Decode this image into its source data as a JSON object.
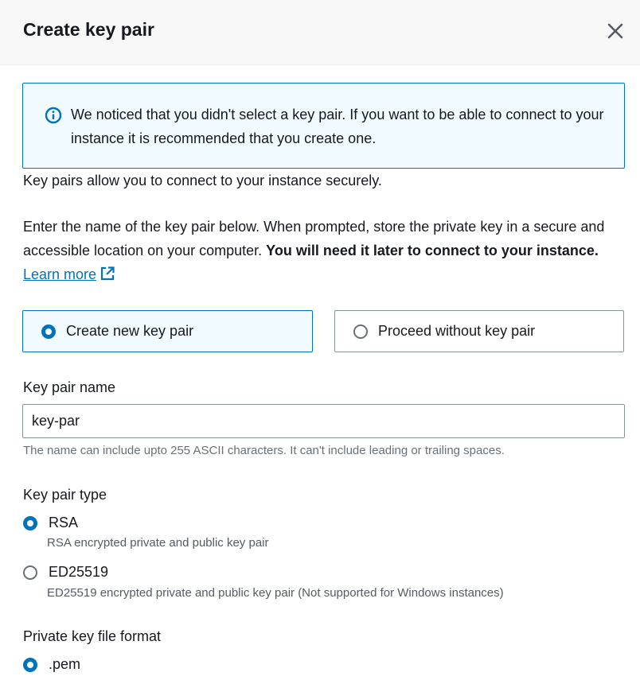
{
  "dialog": {
    "title": "Create key pair",
    "close_icon": "close-icon"
  },
  "alert": {
    "icon": "info-icon",
    "message": "We noticed that you didn't select a key pair. If you want to be able to connect to your instance it is recommended that you create one."
  },
  "intro": {
    "line1": "Key pairs allow you to connect to your instance securely.",
    "line2_prefix": "Enter the name of the key pair below. When prompted, store the private key in a secure and accessible location on your computer. ",
    "line2_bold": "You will need it later to connect to your instance.",
    "learn_more": "Learn more",
    "learn_more_icon": "external-link-icon"
  },
  "choice_tiles": [
    {
      "label": "Create new key pair",
      "selected": true
    },
    {
      "label": "Proceed without key pair",
      "selected": false
    }
  ],
  "key_pair_name": {
    "label": "Key pair name",
    "value": "key-par",
    "hint": "The name can include upto 255 ASCII characters. It can't include leading or trailing spaces."
  },
  "key_pair_type": {
    "label": "Key pair type",
    "options": [
      {
        "label": "RSA",
        "description": "RSA encrypted private and public key pair",
        "selected": true
      },
      {
        "label": "ED25519",
        "description": "ED25519 encrypted private and public key pair (Not supported for Windows instances)",
        "selected": false
      }
    ]
  },
  "private_key_format": {
    "label": "Private key file format",
    "options": [
      {
        "label": ".pem",
        "selected": true
      }
    ]
  },
  "colors": {
    "accent": "#0073bb",
    "selected_bg": "#f1faff",
    "border": "#879596",
    "text": "#16191f",
    "muted": "#687078"
  }
}
